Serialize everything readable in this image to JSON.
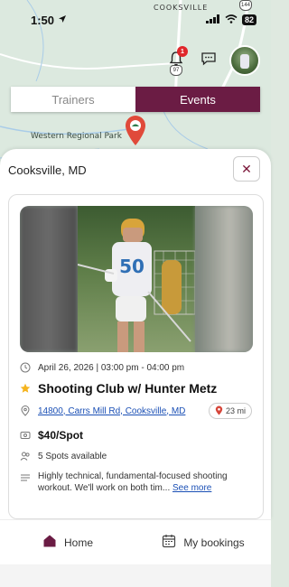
{
  "status_bar": {
    "time": "1:50",
    "battery": "82"
  },
  "map": {
    "place_label": "COOKSVILLE",
    "park_label": "Western Regional Park",
    "route_144": "144",
    "route_97": "97"
  },
  "header": {
    "notification_count": "1"
  },
  "toggle": {
    "trainers": "Trainers",
    "events": "Events"
  },
  "sheet": {
    "location": "Cooksville, MD",
    "close": "✕"
  },
  "event": {
    "datetime": "April 26, 2026 | 03:00 pm - 04:00 pm",
    "title": "Shooting Club w/ Hunter Metz",
    "address": "14800, Carrs Mill Rd, Cooksville, MD",
    "distance": "23 mi",
    "price": "$40/Spot",
    "spots": "5 Spots available",
    "description": "Highly technical, fundamental-focused shooting workout. We'll work on both tim...",
    "see_more": "See more",
    "jersey_number": "50"
  },
  "nav": {
    "home": "Home",
    "bookings": "My bookings"
  },
  "colors": {
    "accent": "#6b1c44",
    "link": "#1a4fb5",
    "pin": "#e04a3a"
  }
}
